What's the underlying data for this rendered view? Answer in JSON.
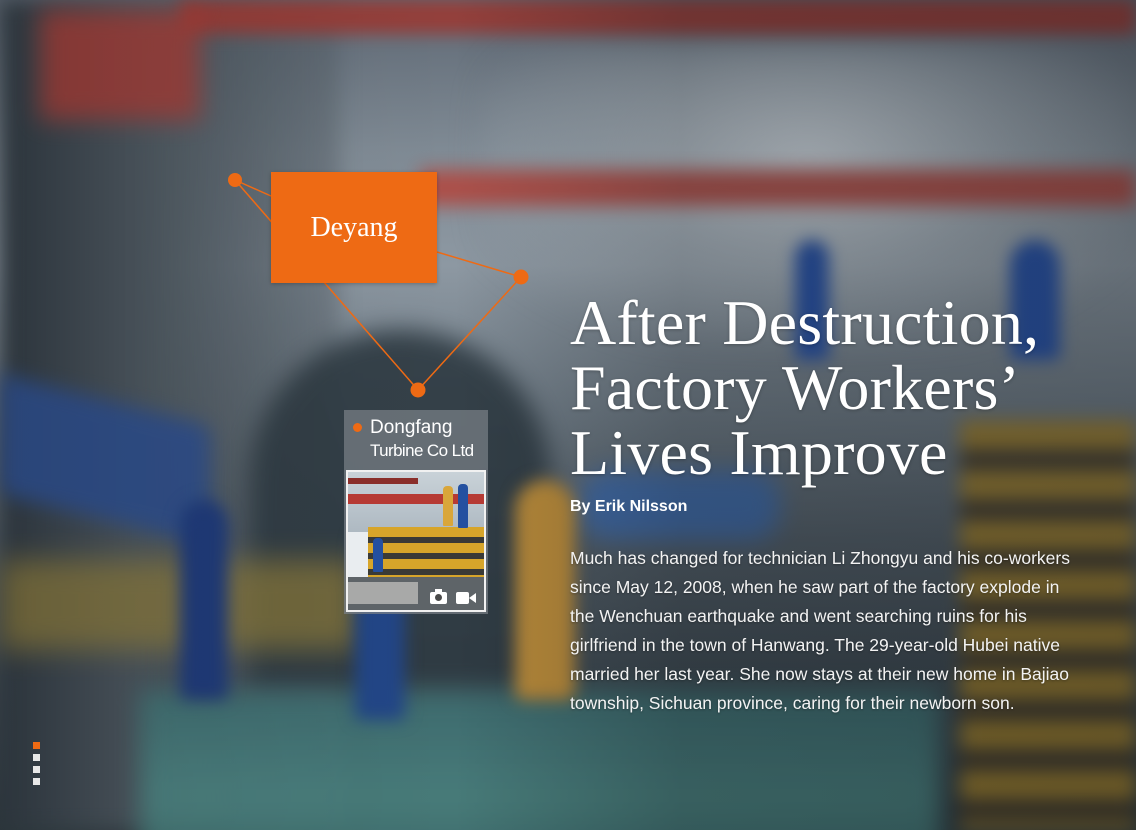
{
  "colors": {
    "accent": "#ee6a14",
    "text": "#ffffff"
  },
  "map": {
    "primary_label": "Deyang",
    "location_card": {
      "title_line1": "Dongfang",
      "title_line2": "Turbine Co Ltd",
      "media_icons": [
        "camera-icon",
        "video-icon"
      ]
    }
  },
  "article": {
    "headline_lines": [
      "After Destruction,",
      "Factory Workers’",
      "Lives Improve"
    ],
    "byline": "By Erik Nilsson",
    "body": "Much has changed for technician Li Zhongyu and his co-workers since May 12, 2008, when he saw part of the factory explode in the Wenchuan earthquake and went searching ruins for his girlfriend in the town of Hanwang. The 29-year-old Hubei native married her last year. She now stays at their new home in Bajiao township, Sichuan province, caring for their newborn son."
  },
  "pager": {
    "total": 4,
    "active": 1
  }
}
